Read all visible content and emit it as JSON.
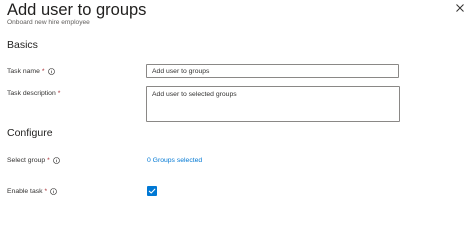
{
  "header": {
    "title": "Add user to groups",
    "subtitle": "Onboard new hire employee"
  },
  "sections": {
    "basics": "Basics",
    "configure": "Configure"
  },
  "fields": {
    "task_name": {
      "label": "Task name",
      "required": "*",
      "value": "Add user to groups"
    },
    "task_description": {
      "label": "Task description",
      "required": "*",
      "value": "Add user to selected groups"
    },
    "select_group": {
      "label": "Select group",
      "required": "*",
      "link_text": "0 Groups selected"
    },
    "enable_task": {
      "label": "Enable task",
      "required": "*",
      "checked": true
    }
  },
  "icons": {
    "close": "close-icon",
    "info": "info-icon",
    "check": "checkmark-icon"
  },
  "colors": {
    "accent": "#0078d4",
    "required": "#a4262c",
    "border": "#8a8886"
  }
}
